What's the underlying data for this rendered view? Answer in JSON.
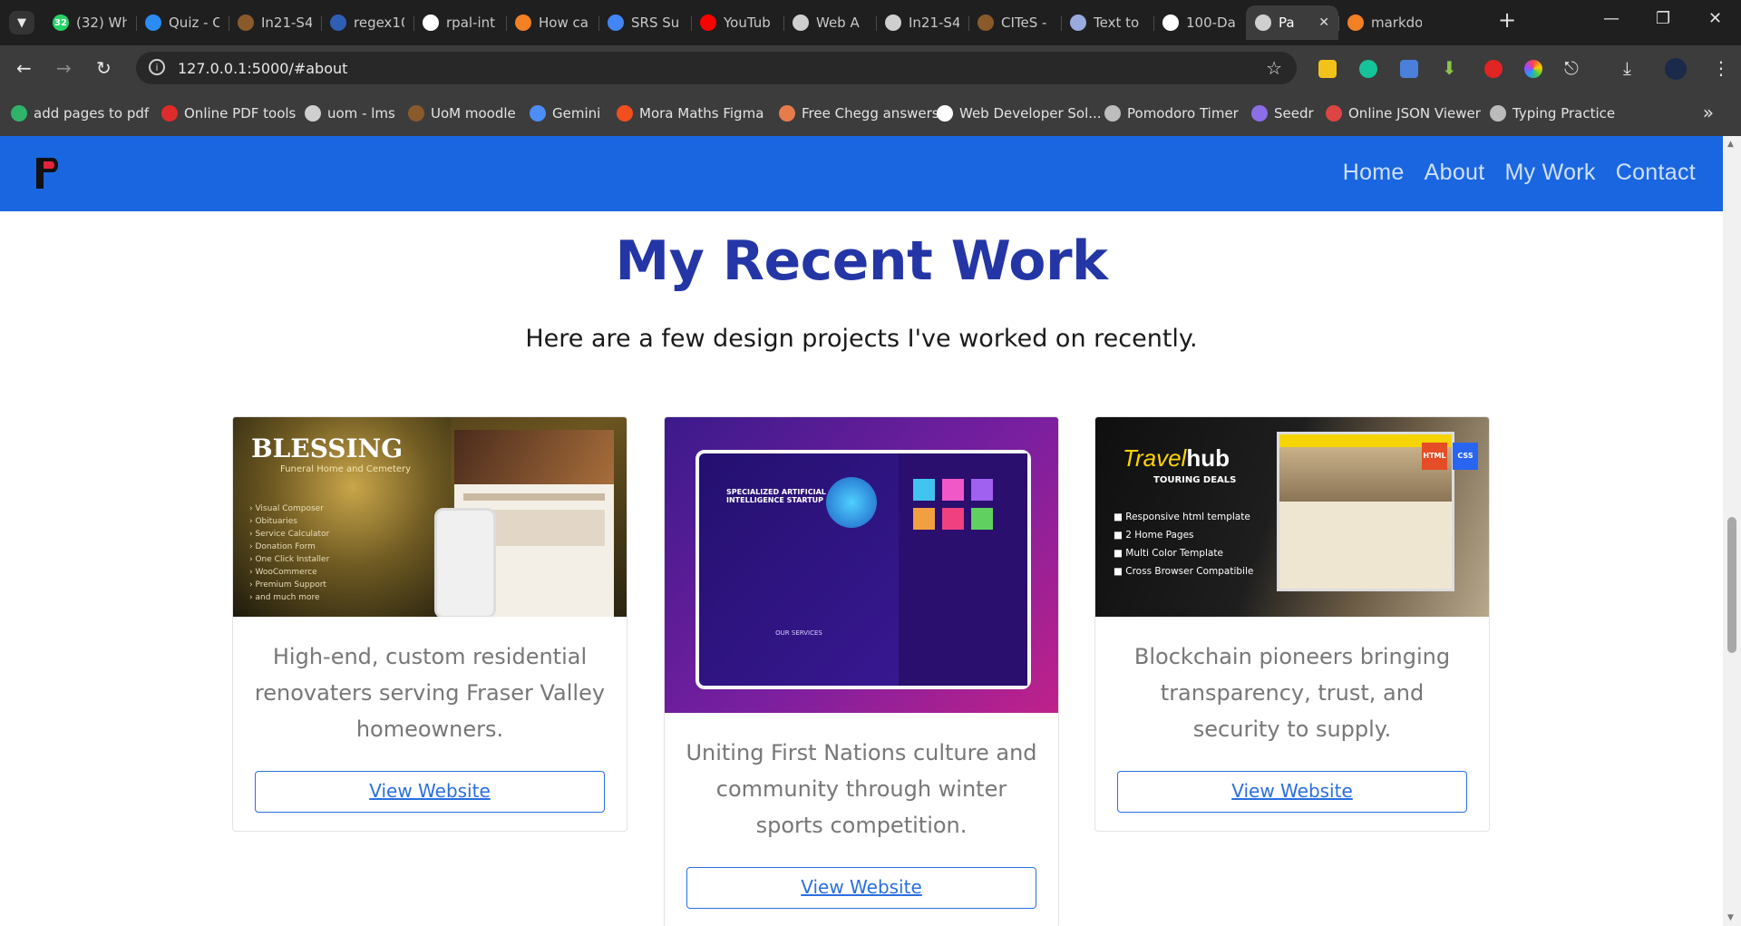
{
  "browser": {
    "tabs": [
      {
        "title": "(32) Wh",
        "icon": "whatsapp-icon",
        "color": "#25d366",
        "badge": "32"
      },
      {
        "title": "Quiz - C",
        "icon": "onedrive-icon",
        "color": "#2c8cf4"
      },
      {
        "title": "In21-S4",
        "icon": "uom-icon",
        "color": "#8a5a2b"
      },
      {
        "title": "regex10",
        "icon": "regex-icon",
        "color": "#2f5fb5"
      },
      {
        "title": "rpal-int",
        "icon": "github-icon",
        "color": "#ffffff"
      },
      {
        "title": "How ca",
        "icon": "stackoverflow-icon",
        "color": "#f48024"
      },
      {
        "title": "SRS Su",
        "icon": "docs-icon",
        "color": "#4285f4"
      },
      {
        "title": "YouTub",
        "icon": "youtube-icon",
        "color": "#ff0000"
      },
      {
        "title": "Web A",
        "icon": "chatgpt-icon",
        "color": "#cfcfcf"
      },
      {
        "title": "In21-S4",
        "icon": "chatgpt-icon",
        "color": "#cfcfcf"
      },
      {
        "title": "CITeS -",
        "icon": "uom-icon",
        "color": "#8a5a2b"
      },
      {
        "title": "Text to",
        "icon": "openai-icon",
        "color": "#9ad"
      },
      {
        "title": "100-Da",
        "icon": "github-icon",
        "color": "#ffffff"
      },
      {
        "title": "Pa",
        "icon": "globe-icon",
        "color": "#cfcfcf",
        "active": true
      },
      {
        "title": "markdo",
        "icon": "stackoverflow-icon",
        "color": "#f48024"
      }
    ],
    "address_url": "127.0.0.1:5000/#about",
    "bookmarks": [
      {
        "label": "add pages to pdf",
        "icon": "s-icon",
        "color": "#2fb36b"
      },
      {
        "label": "Online PDF tools",
        "icon": "heart-icon",
        "color": "#e02b2b"
      },
      {
        "label": "uom - lms",
        "icon": "globe-icon",
        "color": "#cfcfcf"
      },
      {
        "label": "UoM moodle",
        "icon": "uom-icon",
        "color": "#8a5a2b"
      },
      {
        "label": "Gemini",
        "icon": "gemini-icon",
        "color": "#4c8df6"
      },
      {
        "label": "Mora Maths Figma",
        "icon": "figma-icon",
        "color": "#f24e1e"
      },
      {
        "label": "Free Chegg answers",
        "icon": "book-icon",
        "color": "#e57c4b"
      },
      {
        "label": "Web Developer Sol...",
        "icon": "github-icon",
        "color": "#ffffff"
      },
      {
        "label": "Pomodoro Timer",
        "icon": "check-circle-icon",
        "color": "#bdbdbd"
      },
      {
        "label": "Seedr",
        "icon": "seedr-icon",
        "color": "#8c6ee6"
      },
      {
        "label": "Online JSON Viewer",
        "icon": "json-icon",
        "color": "#d44"
      },
      {
        "label": "Typing Practice",
        "icon": "keyboard-icon",
        "color": "#bbbbbb"
      }
    ]
  },
  "site": {
    "nav": [
      "Home",
      "About",
      "My Work",
      "Contact"
    ],
    "heading": "My Recent Work",
    "subheading": "Here are a few design projects I've worked on recently.",
    "projects": [
      {
        "description": "High-end, custom residential renovaters serving Fraser Valley homeowners.",
        "button": "View Website",
        "image": {
          "brand": "BLESSING",
          "tagline": "Funeral Home and Cemetery",
          "features": [
            "Visual Composer",
            "Obituaries",
            "Service Calculator",
            "Donation Form",
            "One Click Installer",
            "WooCommerce",
            "Premium Support",
            "and much more"
          ]
        }
      },
      {
        "description": "Uniting First Nations culture and community through winter sports competition.",
        "button": "View Website",
        "image": {
          "hero_title": "SPECIALIZED ARTIFICIAL INTELLIGENCE STARTUP",
          "section": "OUR SERVICES"
        }
      },
      {
        "description": "Blockchain pioneers bringing transparency, trust, and security to supply.",
        "button": "View Website",
        "image": {
          "brand_a": "Travel",
          "brand_b": "hub",
          "tagline": "TOURING DEALS",
          "features": [
            "Responsive html template",
            "2 Home Pages",
            "Multi Color Template",
            "Cross Browser Compatibile"
          ],
          "badges": [
            "HTML",
            "CSS"
          ]
        }
      }
    ]
  }
}
